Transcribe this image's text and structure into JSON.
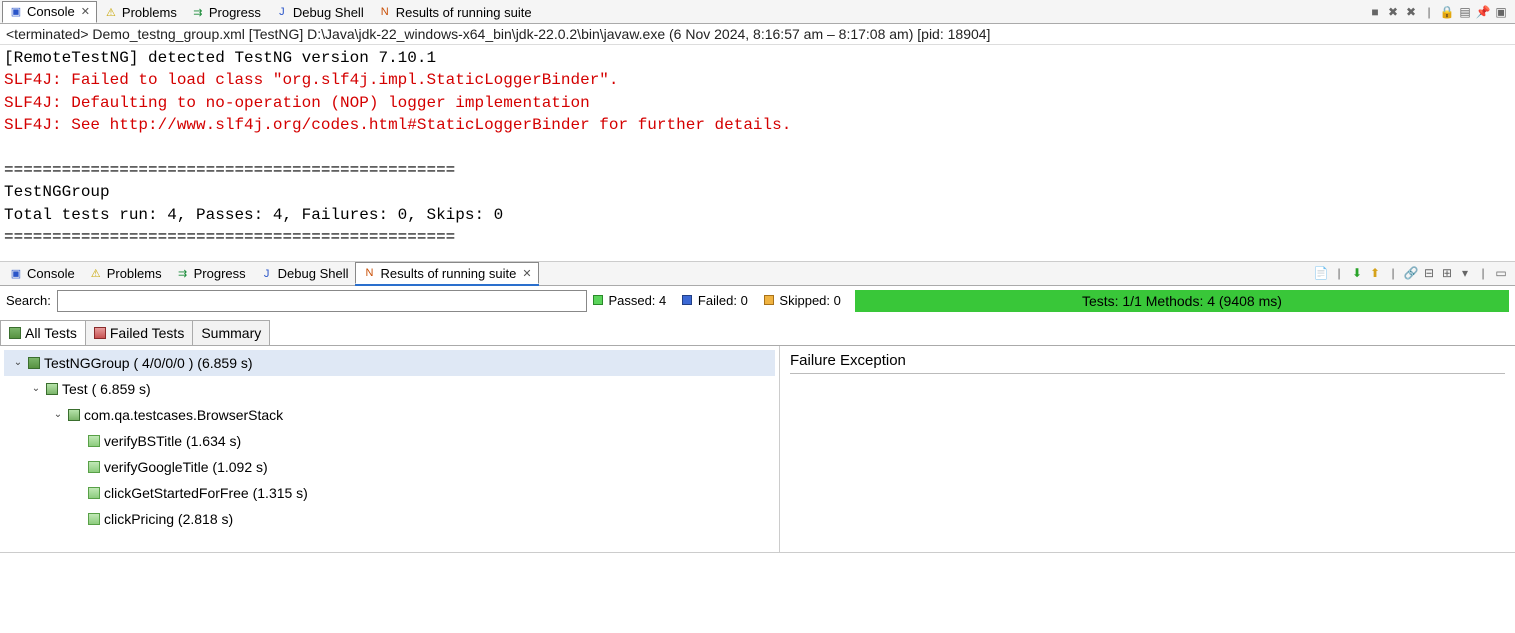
{
  "top": {
    "tabs": {
      "console": "Console",
      "problems": "Problems",
      "progress": "Progress",
      "debug": "Debug Shell",
      "results": "Results of running suite"
    },
    "terminated": "<terminated> Demo_testng_group.xml [TestNG] D:\\Java\\jdk-22_windows-x64_bin\\jdk-22.0.2\\bin\\javaw.exe  (6 Nov 2024, 8:16:57 am – 8:17:08 am) [pid: 18904]",
    "console_lines": {
      "l0": "[RemoteTestNG] detected TestNG version 7.10.1",
      "l1": "SLF4J: Failed to load class \"org.slf4j.impl.StaticLoggerBinder\".",
      "l2": "SLF4J: Defaulting to no-operation (NOP) logger implementation",
      "l3": "SLF4J: See http://www.slf4j.org/codes.html#StaticLoggerBinder for further details.",
      "blank1": "",
      "sep1": "===============================================",
      "l4": "TestNGGroup",
      "l5": "Total tests run: 4, Passes: 4, Failures: 0, Skips: 0",
      "sep2": "==============================================="
    }
  },
  "bottom": {
    "tabs": {
      "console": "Console",
      "problems": "Problems",
      "progress": "Progress",
      "debug": "Debug Shell",
      "results": "Results of running suite"
    },
    "search_label": "Search:",
    "search_value": "",
    "passed_label": "Passed:",
    "passed_count": "4",
    "failed_label": "Failed:",
    "failed_count": "0",
    "skipped_label": "Skipped:",
    "skipped_count": "0",
    "status_text": "Tests: 1/1  Methods: 4 (9408 ms)",
    "inner_tabs": {
      "all": "All Tests",
      "failed": "Failed Tests",
      "summary": "Summary"
    },
    "tree": {
      "suite": "TestNGGroup ( 4/0/0/0 ) (6.859 s)",
      "test": "Test ( 6.859 s)",
      "class": "com.qa.testcases.BrowserStack",
      "m1": "verifyBSTitle  (1.634 s)",
      "m2": "verifyGoogleTitle  (1.092 s)",
      "m3": "clickGetStartedForFree  (1.315 s)",
      "m4": "clickPricing  (2.818 s)"
    },
    "failure_header": "Failure Exception"
  }
}
